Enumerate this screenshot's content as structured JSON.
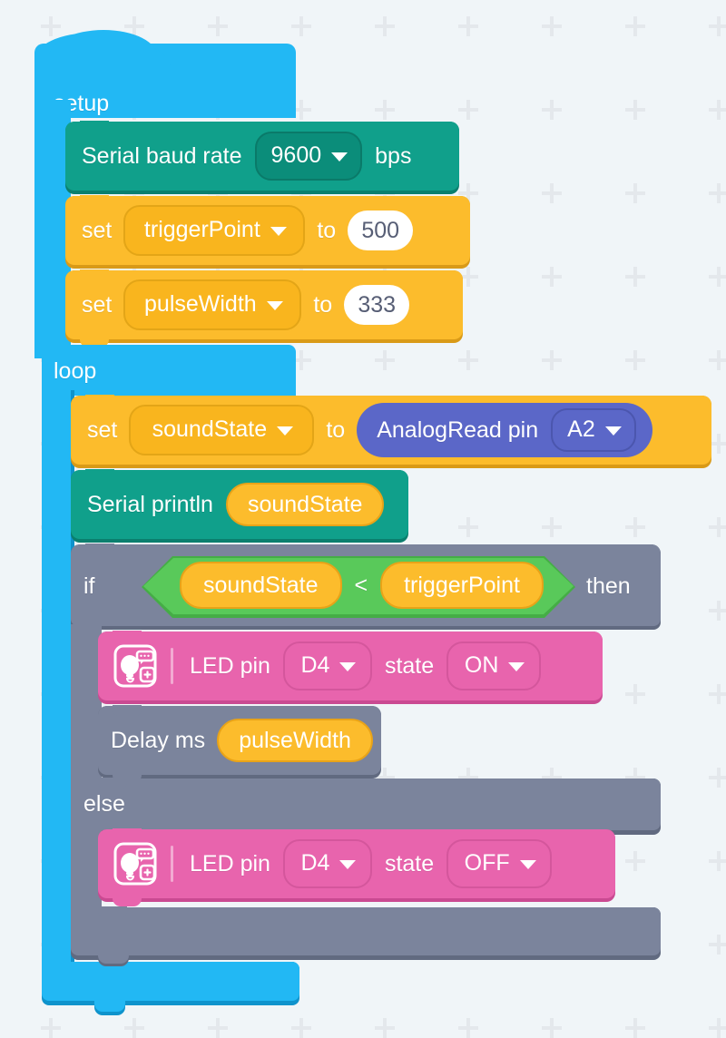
{
  "workspace": {
    "background_color": "#f0f5f8",
    "grid_mark": "plus-grid-mark"
  },
  "palette": {
    "event_blue": "#22b8f4",
    "serial_teal": "#10a08b",
    "variable_orange": "#fcbc2c",
    "control_gray": "#7b849c",
    "operator_green": "#59c95a",
    "actuator_pink": "#e864ad",
    "sensor_purple": "#5b67c8",
    "value_white": "#ffffff",
    "value_text": "#575e75"
  },
  "script": {
    "setup": {
      "label": "setup",
      "blocks": {
        "serial_baud": {
          "prefix": "Serial baud rate",
          "value": "9600",
          "suffix": "bps",
          "dropdown_icon": "chevron-down-icon"
        },
        "set_trigger_point": {
          "prefix": "set",
          "variable": "triggerPoint",
          "middle": "to",
          "value": "500",
          "dropdown_icon": "chevron-down-icon"
        },
        "set_pulse_width": {
          "prefix": "set",
          "variable": "pulseWidth",
          "middle": "to",
          "value": "333",
          "dropdown_icon": "chevron-down-icon"
        }
      }
    },
    "loop": {
      "label": "loop",
      "blocks": {
        "set_sound_state": {
          "prefix": "set",
          "variable": "soundState",
          "middle": "to",
          "dropdown_icon": "chevron-down-icon",
          "reporter": {
            "label": "AnalogRead pin",
            "pin": "A2",
            "dropdown_icon": "chevron-down-icon"
          }
        },
        "serial_println": {
          "label": "Serial println",
          "argument": "soundState"
        },
        "if_else": {
          "if_label": "if",
          "then_label": "then",
          "else_label": "else",
          "condition": {
            "left": "soundState",
            "operator": "<",
            "right": "triggerPoint"
          },
          "then_branch": {
            "led": {
              "icon": "led-bulb-icon",
              "prefix": "LED pin",
              "pin": "D4",
              "middle": "state",
              "state": "ON",
              "dropdown_icon": "chevron-down-icon"
            },
            "delay": {
              "label": "Delay ms",
              "argument": "pulseWidth"
            }
          },
          "else_branch": {
            "led": {
              "icon": "led-bulb-icon",
              "prefix": "LED pin",
              "pin": "D4",
              "middle": "state",
              "state": "OFF",
              "dropdown_icon": "chevron-down-icon"
            }
          }
        }
      }
    }
  }
}
